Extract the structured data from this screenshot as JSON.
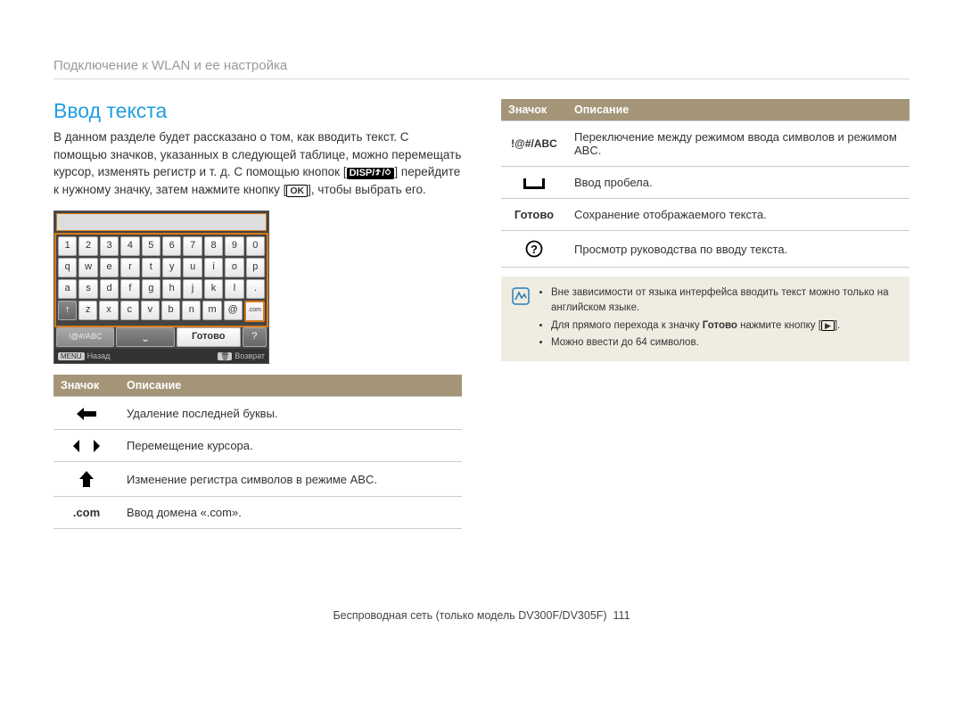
{
  "breadcrumb": "Подключение к WLAN и ее настройка",
  "title": "Ввод текста",
  "intro_parts": {
    "p1": "В данном разделе будет рассказано о том, как вводить текст. С помощью значков, указанных в следующей таблице, можно перемещать курсор, изменять регистр и т. д. С помощью кнопок [",
    "disp": "DISP/",
    "p2": "] перейдите к нужному значку, затем нажмите кнопку [",
    "ok": "OK",
    "p3": "], чтобы выбрать его."
  },
  "keyboard": {
    "rows": [
      [
        "1",
        "2",
        "3",
        "4",
        "5",
        "6",
        "7",
        "8",
        "9",
        "0"
      ],
      [
        "q",
        "w",
        "e",
        "r",
        "t",
        "y",
        "u",
        "i",
        "o",
        "p"
      ],
      [
        "a",
        "s",
        "d",
        "f",
        "g",
        "h",
        "j",
        "k",
        "l",
        "."
      ]
    ],
    "row4_shift": "↑",
    "row4_keys": [
      "z",
      "x",
      "c",
      "v",
      "b",
      "n",
      "m",
      "@"
    ],
    "row4_last": ".com",
    "row5_abc": "!@#/ABC",
    "row5_space": "⎵",
    "row5_done": "Готово",
    "row5_q": "?",
    "menu_label": "MENU",
    "back_label": "Назад",
    "trash_label": "Возврат"
  },
  "left_table": {
    "head_icon": "Значок",
    "head_desc": "Описание",
    "rows": [
      {
        "icon": "arrow-back",
        "desc": "Удаление последней буквы."
      },
      {
        "icon": "arrows-lr",
        "desc": "Перемещение курсора."
      },
      {
        "icon": "arrow-up",
        "desc": "Изменение регистра символов в режиме ABC."
      },
      {
        "icon": "com",
        "label": ".com",
        "desc": "Ввод домена «.com»."
      }
    ]
  },
  "right_table": {
    "head_icon": "Значок",
    "head_desc": "Описание",
    "rows": [
      {
        "icon": "abc",
        "label": "!@#/ABC",
        "desc": "Переключение между режимом ввода символов и режимом ABC."
      },
      {
        "icon": "space",
        "desc": "Ввод пробела."
      },
      {
        "icon": "done",
        "label": "Готово",
        "desc": "Сохранение отображаемого текста."
      },
      {
        "icon": "help",
        "desc": "Просмотр руководства по вводу текста."
      }
    ]
  },
  "note": {
    "items_parts": [
      {
        "pre": "Вне зависимости от языка интерфейса вводить текст можно только на английском языке."
      },
      {
        "pre": "Для прямого перехода к значку ",
        "bold": "Готово",
        "post": " нажмите кнопку [",
        "btn": "▶",
        "tail": "]."
      },
      {
        "pre": "Можно ввести до 64 символов."
      }
    ]
  },
  "footer": {
    "text": "Беспроводная сеть  (только модель DV300F/DV305F)",
    "page": "111"
  }
}
